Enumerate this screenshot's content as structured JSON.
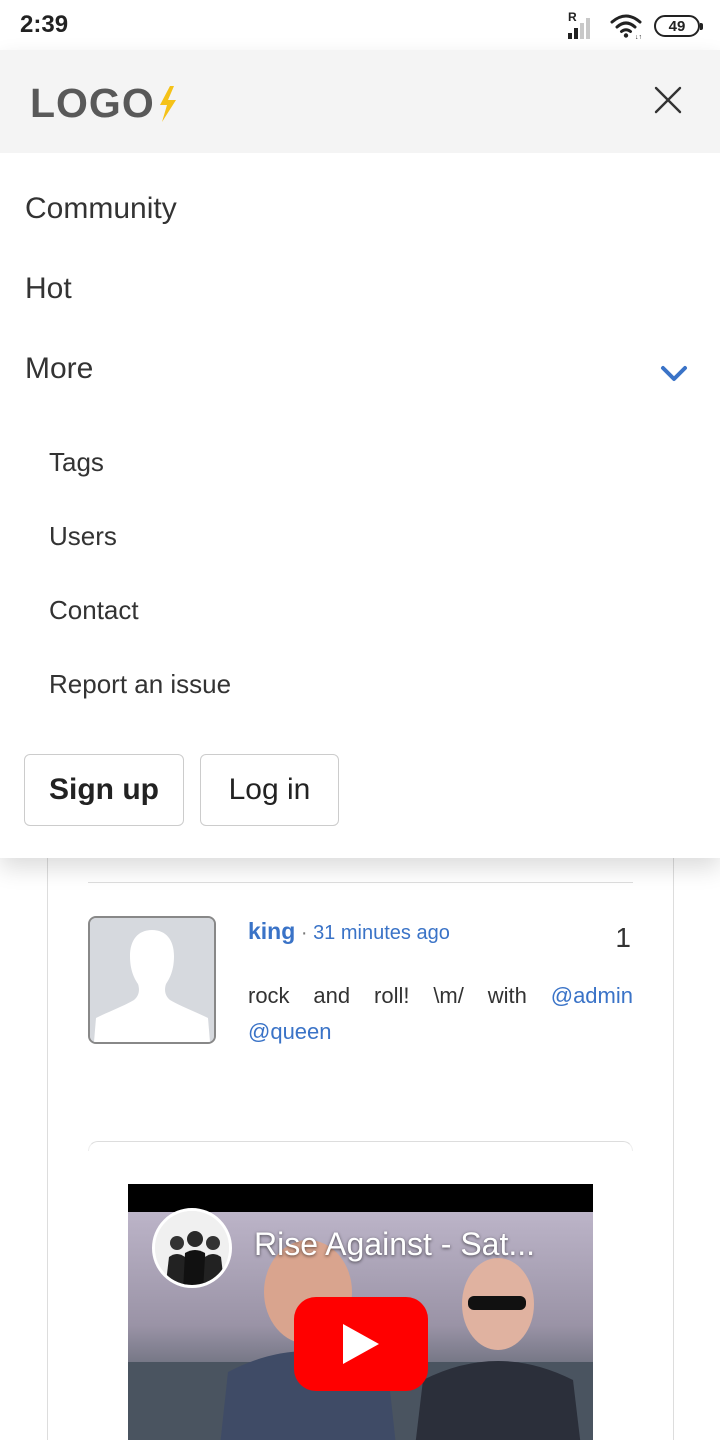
{
  "status_bar": {
    "time": "2:39",
    "signal_label": "R",
    "battery": "49"
  },
  "header": {
    "logo_text": "LOGO",
    "logo_accent": "#f5c218"
  },
  "menu": {
    "items": [
      {
        "label": "Community"
      },
      {
        "label": "Hot"
      },
      {
        "label": "More"
      }
    ],
    "sub_items": [
      {
        "label": "Tags"
      },
      {
        "label": "Users"
      },
      {
        "label": "Contact"
      },
      {
        "label": "Report an issue"
      }
    ],
    "signup_label": "Sign up",
    "login_label": "Log in",
    "accent_color": "#3a73c7"
  },
  "comment": {
    "author": "king",
    "separator": " · ",
    "time_ago": "31 minutes ago",
    "votes": "1",
    "text_prefix": "rock and roll! \\m/ with ",
    "mention_1": "@admin",
    "mention_2": "@queen"
  },
  "video": {
    "title": "Rise Against - Sat..."
  }
}
